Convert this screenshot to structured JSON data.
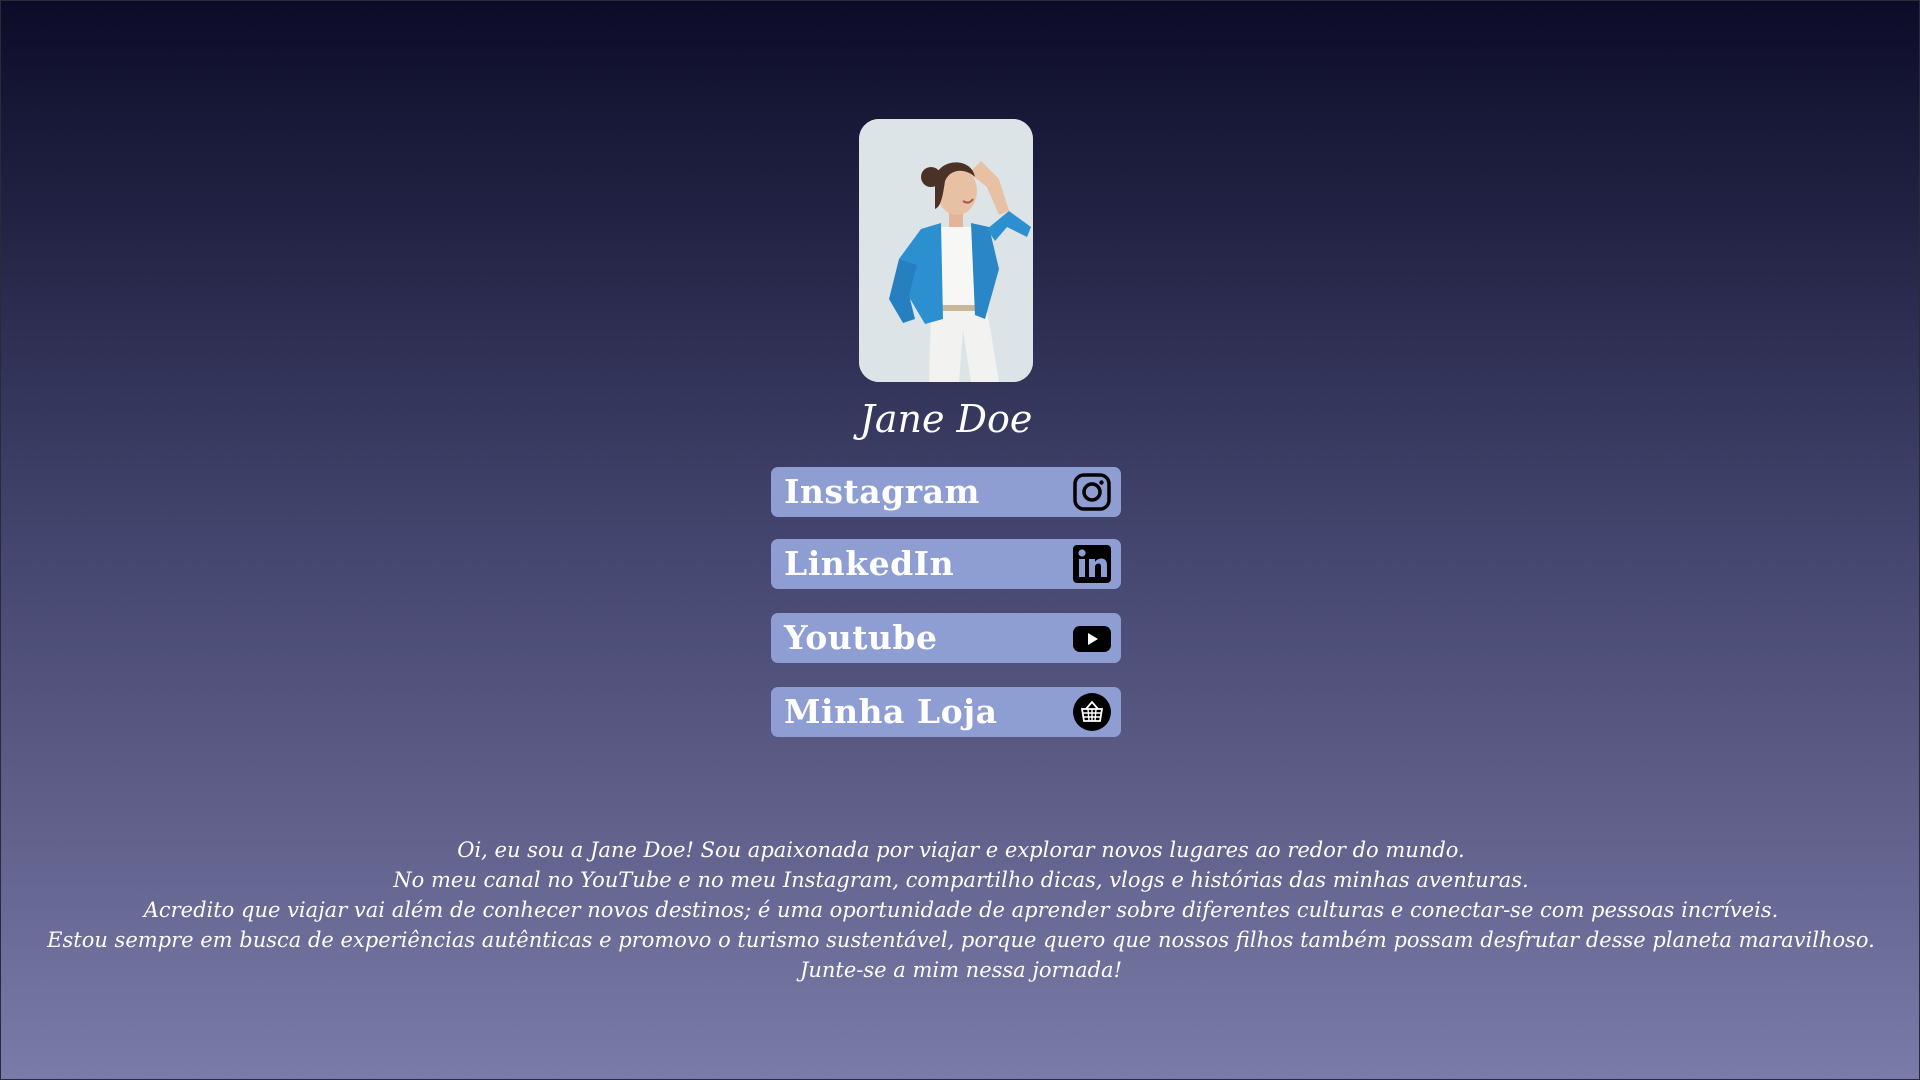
{
  "profile": {
    "name": "Jane Doe",
    "photo_alt": "profile-photo"
  },
  "links": [
    {
      "label": "Instagram",
      "icon": "instagram-icon"
    },
    {
      "label": "LinkedIn",
      "icon": "linkedin-icon"
    },
    {
      "label": "Youtube",
      "icon": "youtube-icon"
    },
    {
      "label": "Minha Loja",
      "icon": "shopping-basket-icon"
    }
  ],
  "bio": {
    "lines": [
      "Oi, eu sou a Jane Doe! Sou apaixonada por viajar e explorar novos lugares ao redor do mundo.",
      "No meu canal no YouTube e no meu Instagram, compartilho dicas, vlogs e histórias das minhas aventuras.",
      "Acredito que viajar vai além de conhecer novos destinos; é uma oportunidade de aprender sobre diferentes culturas e conectar-se com pessoas incríveis.",
      "Estou sempre em busca de experiências autênticas e promovo o turismo sustentável, porque quero que nossos filhos também possam desfrutar desse planeta maravilhoso.",
      "Junte-se a mim nessa jornada!"
    ]
  },
  "colors": {
    "button_bg": "#8e9ed2",
    "text": "#ffffff",
    "gradient_top": "#0c0c29",
    "gradient_bottom": "#7a7ba8"
  }
}
